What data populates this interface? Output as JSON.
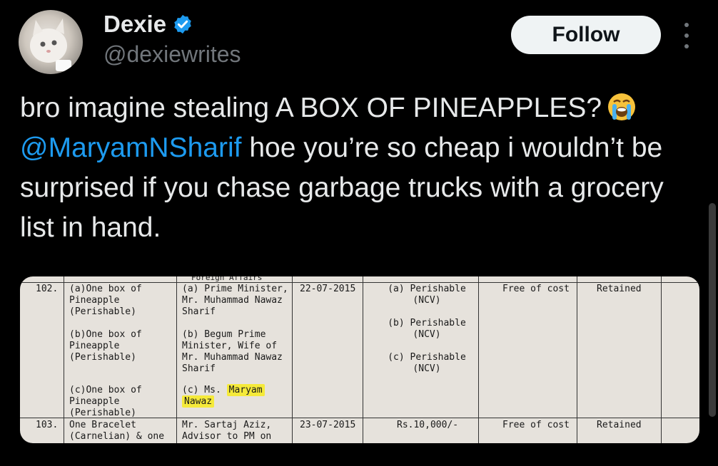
{
  "author": {
    "name": "Dexie",
    "handle": "@dexiewrites",
    "verified_icon": "verified-badge-icon",
    "avatar_icon": "cat-avatar"
  },
  "follow_label": "Follow",
  "tweet": {
    "text_part1": "bro imagine stealing A BOX OF PINEAPPLES?",
    "emoji": "loudly-crying-face",
    "mention": "@MaryamNSharif",
    "text_part2": " hoe you’re so cheap i wouldn’t be surprised if you chase garbage trucks with a grocery list in hand."
  },
  "colors": {
    "background": "#000000",
    "text": "#e7e9ea",
    "secondary": "#71767b",
    "link": "#1d9bf0",
    "highlight": "#f5ea3a"
  },
  "document": {
    "header_fragment": "Foreign Affairs",
    "rows": [
      {
        "no": "102.",
        "items": [
          "(a)One box of Pineapple (Perishable)",
          "(b)One box of Pineapple (Perishable)",
          "(c)One box of Pineapple (Perishable)"
        ],
        "recipients": [
          "(a) Prime Minister, Mr. Muhammad Nawaz Sharif",
          "(b) Begum Prime Minister, Wife of Mr. Muhammad Nawaz Sharif",
          "(c) Ms. Maryam Nawaz"
        ],
        "date": "22-07-2015",
        "value": [
          "(a) Perishable (NCV)",
          "(b) Perishable (NCV)",
          "(c) Perishable (NCV)"
        ],
        "cost": "Free of cost",
        "status": "Retained"
      },
      {
        "no": "103.",
        "items": [
          "One Bracelet (Carnelian) & one"
        ],
        "recipients": [
          "Mr. Sartaj Aziz, Advisor to PM on"
        ],
        "date": "23-07-2015",
        "value": [
          "Rs.10,000/-"
        ],
        "cost": "Free of cost",
        "status": "Retained"
      }
    ],
    "highlight_words": [
      "Maryam",
      "Nawaz"
    ]
  }
}
